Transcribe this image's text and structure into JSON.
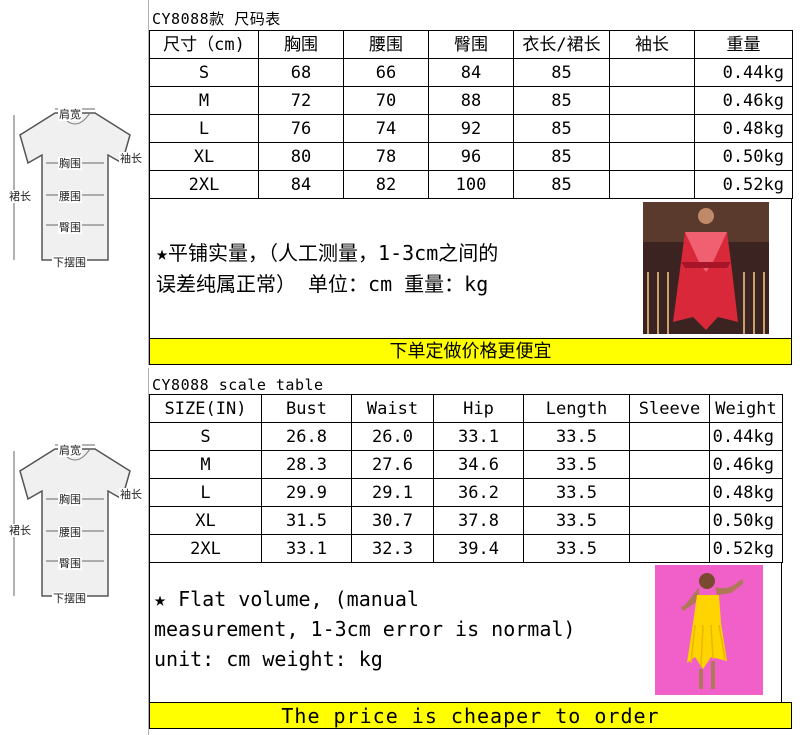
{
  "sheet_cn": {
    "caption": "CY8088款 尺码表",
    "headers": [
      "尺寸（cm)",
      "胸围",
      "腰围",
      "臀围",
      "衣长/裙长",
      "袖长",
      "重量"
    ],
    "rows": [
      [
        "S",
        "68",
        "66",
        "84",
        "85",
        "",
        "0.44kg"
      ],
      [
        "M",
        "72",
        "70",
        "88",
        "85",
        "",
        "0.46kg"
      ],
      [
        "L",
        "76",
        "74",
        "92",
        "85",
        "",
        "0.48kg"
      ],
      [
        "XL",
        "80",
        "78",
        "96",
        "85",
        "",
        "0.50kg"
      ],
      [
        "2XL",
        "84",
        "82",
        "100",
        "85",
        "",
        "0.52kg"
      ]
    ],
    "note_line1": "★平铺实量，（人工测量，1-3cm之间的",
    "note_line2": "误差纯属正常） 单位：cm  重量：kg",
    "banner": "下单定做价格更便宜",
    "photo_icon": "red-fringe-dress-photo"
  },
  "sheet_en": {
    "caption": "CY8088 scale table",
    "headers": [
      "SIZE(IN)",
      "Bust",
      "Waist",
      "Hip",
      "Length",
      "Sleeve",
      "Weight"
    ],
    "rows": [
      [
        "S",
        "26.8",
        "26.0",
        "33.1",
        "33.5",
        "",
        "0.44kg"
      ],
      [
        "M",
        "28.3",
        "27.6",
        "34.6",
        "33.5",
        "",
        "0.46kg"
      ],
      [
        "L",
        "29.9",
        "29.1",
        "36.2",
        "33.5",
        "",
        "0.48kg"
      ],
      [
        "XL",
        "31.5",
        "30.7",
        "37.8",
        "33.5",
        "",
        "0.50kg"
      ],
      [
        "2XL",
        "33.1",
        "32.3",
        "39.4",
        "33.5",
        "",
        "0.52kg"
      ]
    ],
    "note_line1": "★ Flat volume, (manual",
    "note_line2": "measurement, 1-3cm error is normal)",
    "note_line3": "unit: cm weight: kg",
    "banner": "The price is cheaper to order",
    "photo_icon": "yellow-fringe-dress-photo"
  },
  "diagram": {
    "shoulder": "肩宽",
    "sleeve": "袖长",
    "chest": "胸围",
    "length": "裙长",
    "waist": "腰围",
    "hip": "臀围",
    "hem": "下摆围",
    "icon": "dress-measurement-diagram-icon"
  },
  "colors": {
    "banner": "#ffff00",
    "dress_red": "#d8283a",
    "dress_yellow": "#ffd400",
    "photo_pink_bg": "#f060c8"
  }
}
